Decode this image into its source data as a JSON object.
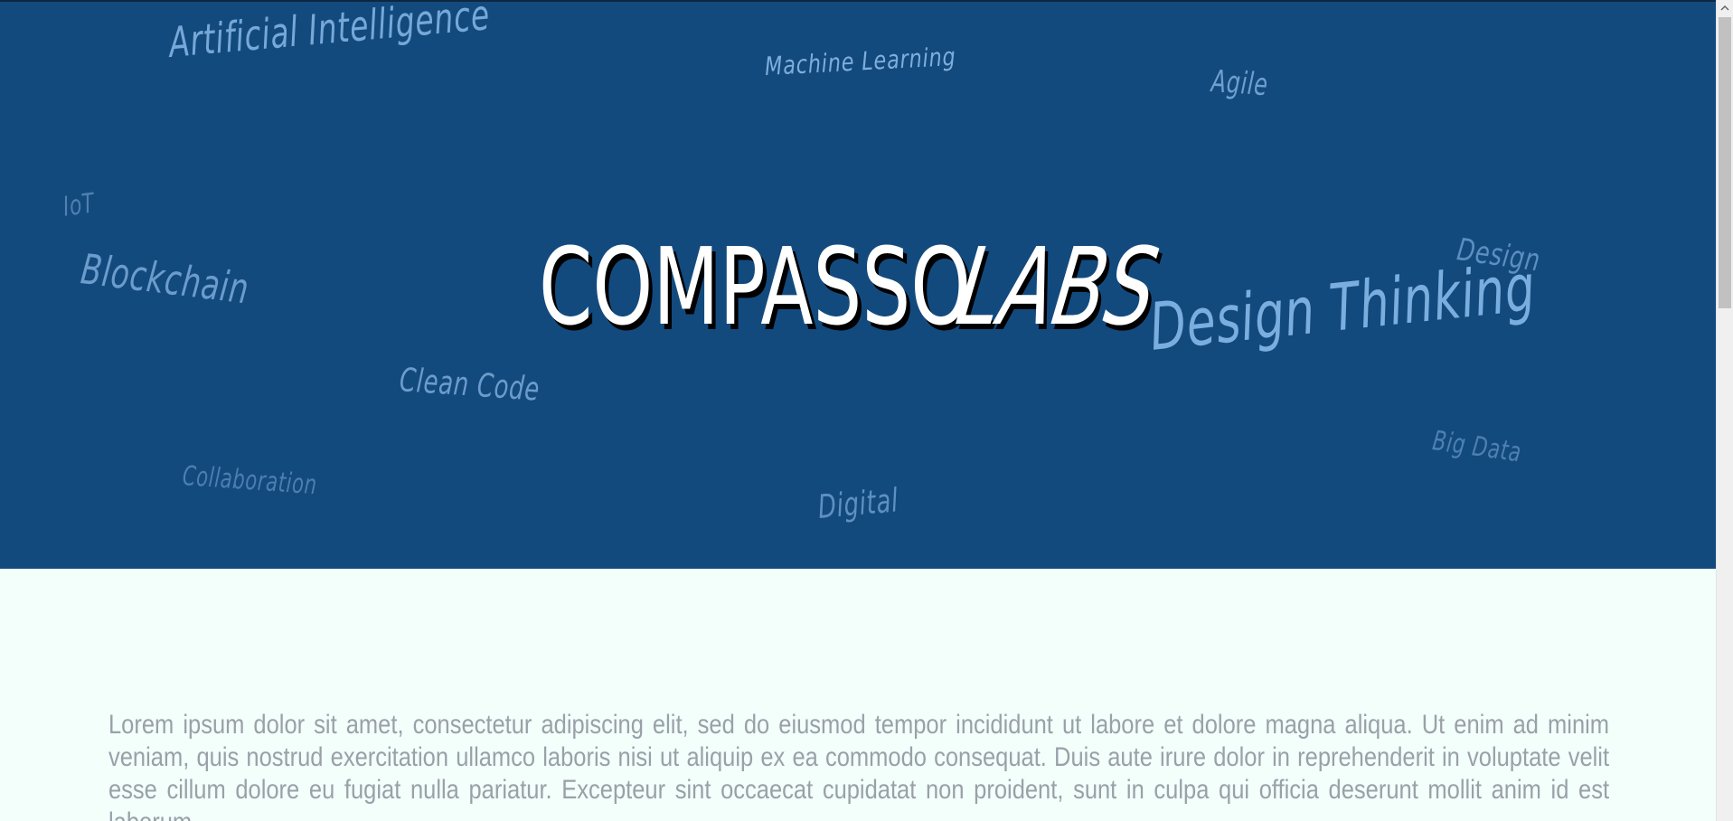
{
  "hero": {
    "logo_main": "COMPASSO",
    "logo_accent": "LABS",
    "keywords": {
      "ai": "Artificial Intelligence",
      "ml": "Machine Learning",
      "agile": "Agile",
      "iot": "IoT",
      "blockchain": "Blockchain",
      "design": "Design",
      "design_thinking": "Design Thinking",
      "clean_code": "Clean Code",
      "big_data": "Big Data",
      "collaboration": "Collaboration",
      "digital": "Digital"
    },
    "background_color": "#134a7e"
  },
  "content": {
    "paragraph": "Lorem ipsum dolor sit amet, consectetur adipiscing elit, sed do eiusmod tempor incididunt ut labore et dolore magna aliqua. Ut enim ad minim veniam, quis nostrud exercitation ullamco laboris nisi ut aliquip ex ea commodo consequat. Duis aute irure dolor in reprehenderit in voluptate velit esse cillum dolore eu fugiat nulla pariatur. Excepteur sint occaecat cupidatat non proident, sunt in culpa qui officia deserunt mollit anim id est laborum."
  },
  "scrollbar": {
    "up_icon": "chevron-up-icon"
  }
}
